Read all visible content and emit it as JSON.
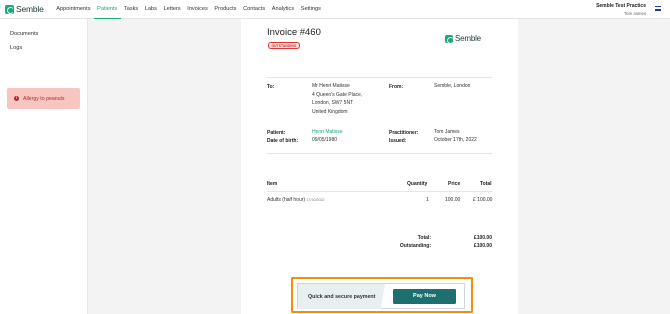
{
  "app": {
    "brand": "Semble",
    "nav": [
      "Appointments",
      "Patients",
      "Tasks",
      "Labs",
      "Letters",
      "Invoices",
      "Products",
      "Contacts",
      "Analytics",
      "Settings"
    ],
    "active_nav": "Patients",
    "user": {
      "practice": "Semble Test Practice",
      "name": "Tom James"
    }
  },
  "sidebar": {
    "items": [
      "Documents",
      "Logs"
    ],
    "alert": "Allergy to peanuts"
  },
  "invoice": {
    "title": "Invoice #460",
    "status": "OUTSTANDING",
    "logo_text": "Semble",
    "to_label": "To:",
    "to_lines": [
      "Mr Henri Matisse",
      "4 Queen's Gate Place,",
      "London, SW7 5NT",
      "United Kingdom"
    ],
    "from_label": "From:",
    "from_value": "Semble, London",
    "patient_label": "Patient:",
    "patient_value": "Henri Matisse",
    "dob_label": "Date of birth:",
    "dob_value": "09/05/1980",
    "practitioner_label": "Practitioner:",
    "practitioner_value": "Tom James",
    "issued_label": "Issued:",
    "issued_value": "October 17th, 2022",
    "columns": {
      "item": "Item",
      "quantity": "Quantity",
      "price": "Price",
      "total": "Total"
    },
    "items": [
      {
        "name": "Adults (half hour)",
        "date": "17/10/2022",
        "quantity": "1",
        "price": "100.00",
        "total": "£ 100.00"
      }
    ],
    "total_label": "Total:",
    "total_value": "£100.00",
    "outstanding_label": "Outstanding:",
    "outstanding_value": "£100.00"
  },
  "payment": {
    "caption": "Quick and secure payment",
    "button": "Pay Now"
  },
  "colors": {
    "accent": "#19a974",
    "pay_button": "#1e6f6f",
    "highlight": "#f0900c",
    "alert_bg": "#f7c6c1",
    "alert_text": "#b32a2a"
  }
}
